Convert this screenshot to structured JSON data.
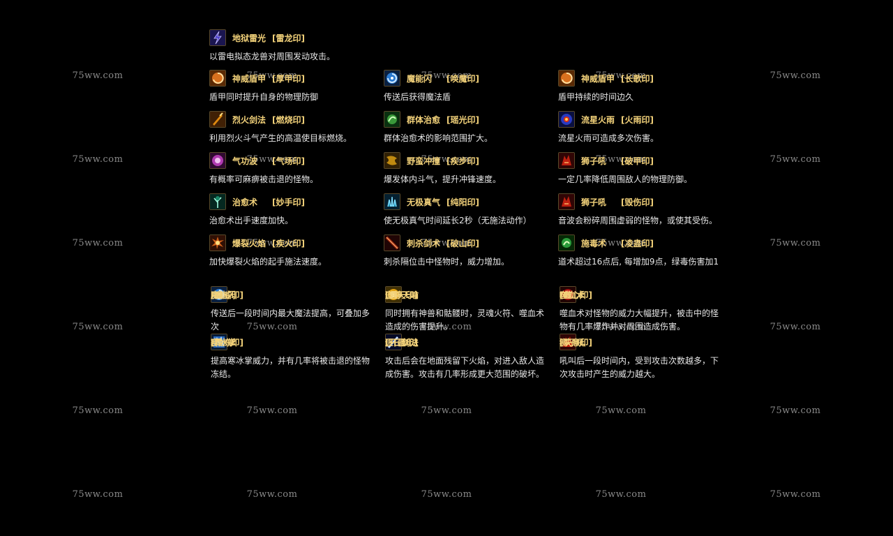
{
  "watermark": "75ww.com",
  "skills_top": [
    {
      "name": "地狱雷光",
      "seal": "[雷龙印]",
      "icon": "lightning-icon",
      "color": "#4a3cc8",
      "desc": "以雷电拟态龙兽对周围发动攻击。"
    },
    {
      "name": "神威盾甲",
      "seal": "[厚甲印]",
      "icon": "shield-swirl-icon",
      "color": "#d8701e",
      "desc": "盾甲同时提升自身的物理防御"
    },
    {
      "name": "魔能闪",
      "seal": "[唤魔印]",
      "icon": "blue-swirl-icon",
      "color": "#2a7ad0",
      "desc": "传送后获得魔法盾"
    },
    {
      "name": "神威盾甲",
      "seal": "[长歌印]",
      "icon": "shield-swirl-icon",
      "color": "#d8701e",
      "desc": "盾甲持续的时间边久"
    },
    {
      "name": "烈火剑法",
      "seal": "[燃烧印]",
      "icon": "fire-sword-icon",
      "color": "#e08a10",
      "desc": "利用烈火斗气产生的高温使目标燃烧。"
    },
    {
      "name": "群体治愈",
      "seal": "[瑶光印]",
      "icon": "heal-icon",
      "color": "#3a9a3a",
      "desc": "群体治愈术的影响范围扩大。"
    },
    {
      "name": "流星火雨",
      "seal": "[火雨印]",
      "icon": "meteor-icon",
      "color": "#2a3ac0",
      "desc": "流星火雨可造成多次伤害。"
    },
    {
      "name": "气功波",
      "seal": "[气场印]",
      "icon": "wave-icon",
      "color": "#b03ab0",
      "desc": "有概率可麻痹被击退的怪物。"
    },
    {
      "name": "野蛮冲撞",
      "seal": "[疾步印]",
      "icon": "charge-icon",
      "color": "#c08a10",
      "desc": "爆发体内斗气，提升冲锋速度。"
    },
    {
      "name": "狮子吼",
      "seal": "[破甲印]",
      "icon": "lion-roar-icon",
      "color": "#c02010",
      "desc": "一定几率降低周围敌人的物理防御。"
    },
    {
      "name": "治愈术",
      "seal": "[妙手印]",
      "icon": "tree-heal-icon",
      "color": "#1a8a6a",
      "desc": "治愈术出手速度加快。"
    },
    {
      "name": "无极真气",
      "seal": "[纯阳印]",
      "icon": "crystal-icon",
      "color": "#1a8ab0",
      "desc": "使无极真气时间延长2秒（无施法动作）"
    },
    {
      "name": "狮子吼",
      "seal": "[毁伤印]",
      "icon": "lion-roar-icon",
      "color": "#c02010",
      "desc": "音波会粉碎周围虚弱的怪物，或使其受伤。"
    },
    {
      "name": "爆裂火焰",
      "seal": "[疾火印]",
      "icon": "explosion-icon",
      "color": "#d0601a",
      "desc": "加快爆裂火焰的起手施法速度。"
    },
    {
      "name": "刺杀剑术",
      "seal": "[破山印]",
      "icon": "sword-thrust-icon",
      "color": "#a02a10",
      "desc": "刺杀隔位击中怪物时，威力增加。"
    },
    {
      "name": "施毒术",
      "seal": "[凌蛊印]",
      "icon": "poison-icon",
      "color": "#2a9a3a",
      "desc": "道术超过16点后, 每增加9点，绿毒伤害加1"
    }
  ],
  "skills_bottom": [
    {
      "name": "魔能闪",
      "seal": "[魔威印]",
      "icon": "blue-swirl-icon",
      "color": "#2a7ad0",
      "desc": "传送后一段时间内最大魔法提高，可叠加多次"
    },
    {
      "name": "道尊天喻",
      "seal": "[通天印]",
      "icon": "sun-icon",
      "color": "#e0a010",
      "desc": "同时拥有神兽和骷髅时，灵魂火符、噬血术造成的伤害提升。"
    },
    {
      "name": "噬血术",
      "seal": "[噬心印]",
      "icon": "blood-icon",
      "color": "#a01010",
      "desc": "噬血术对怪物的威力大幅提升，被击中的怪物有几率爆炸并对周围造成伤害。"
    },
    {
      "name": "寒冰掌",
      "seal": "[霜冻印]",
      "icon": "ice-palm-icon",
      "color": "#2a6ac0",
      "desc": "提高寒冰掌威力，并有几率将被击退的怪物冻结。"
    },
    {
      "name": "逐日剑法",
      "seal": "[开疆印]",
      "icon": "sun-sword-icon",
      "color": "#1a3a9a",
      "desc": "攻击后会在地面残留下火焰，对进入敌人造成伤害。攻击有几率形成更大范围的破坏。"
    },
    {
      "name": "狮子吼",
      "seal": "[决意印]",
      "icon": "lion-roar-icon",
      "color": "#c02010",
      "desc": "吼叫后一段时间内，受到攻击次数越多，下次攻击时产生的威力越大。"
    }
  ]
}
